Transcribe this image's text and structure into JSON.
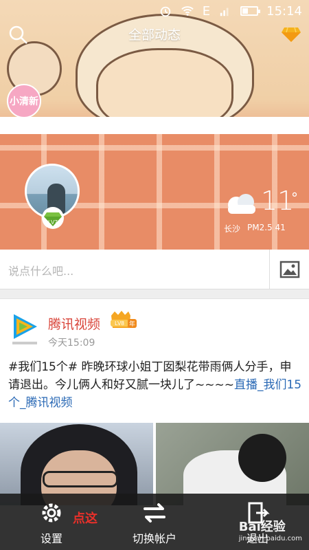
{
  "status_bar": {
    "time": "15:14",
    "network": "E"
  },
  "header": {
    "title": "全部动态"
  },
  "badge": {
    "text": "小清新"
  },
  "profile": {
    "level": "LV7"
  },
  "weather": {
    "temp": "11",
    "degree": "°",
    "city": "长沙",
    "pm_label": "PM2.5 41"
  },
  "composer": {
    "placeholder": "说点什么吧..."
  },
  "post": {
    "author": "腾讯视频",
    "author_level": "LV8",
    "year_badge": "年",
    "time": "今天15:09",
    "text": "#我们15个# 昨晚环球小姐丁囡梨花带雨俩人分手，申请退出。今儿俩人和好又腻一块儿了~~~~",
    "link_text": "直播_我们15个_腾讯视频"
  },
  "bottom_menu": {
    "items": [
      {
        "label": "设置",
        "icon": "gear-icon"
      },
      {
        "label": "切换帐户",
        "icon": "switch-account-icon"
      },
      {
        "label": "退出",
        "icon": "exit-icon"
      }
    ],
    "highlight": "点这"
  },
  "watermark": {
    "text": "Bai经验",
    "sub": "jingyan.baidu.com"
  },
  "colors": {
    "accent_red": "#d9463b",
    "link_blue": "#2a69b5",
    "menu_bg": "#191919"
  }
}
